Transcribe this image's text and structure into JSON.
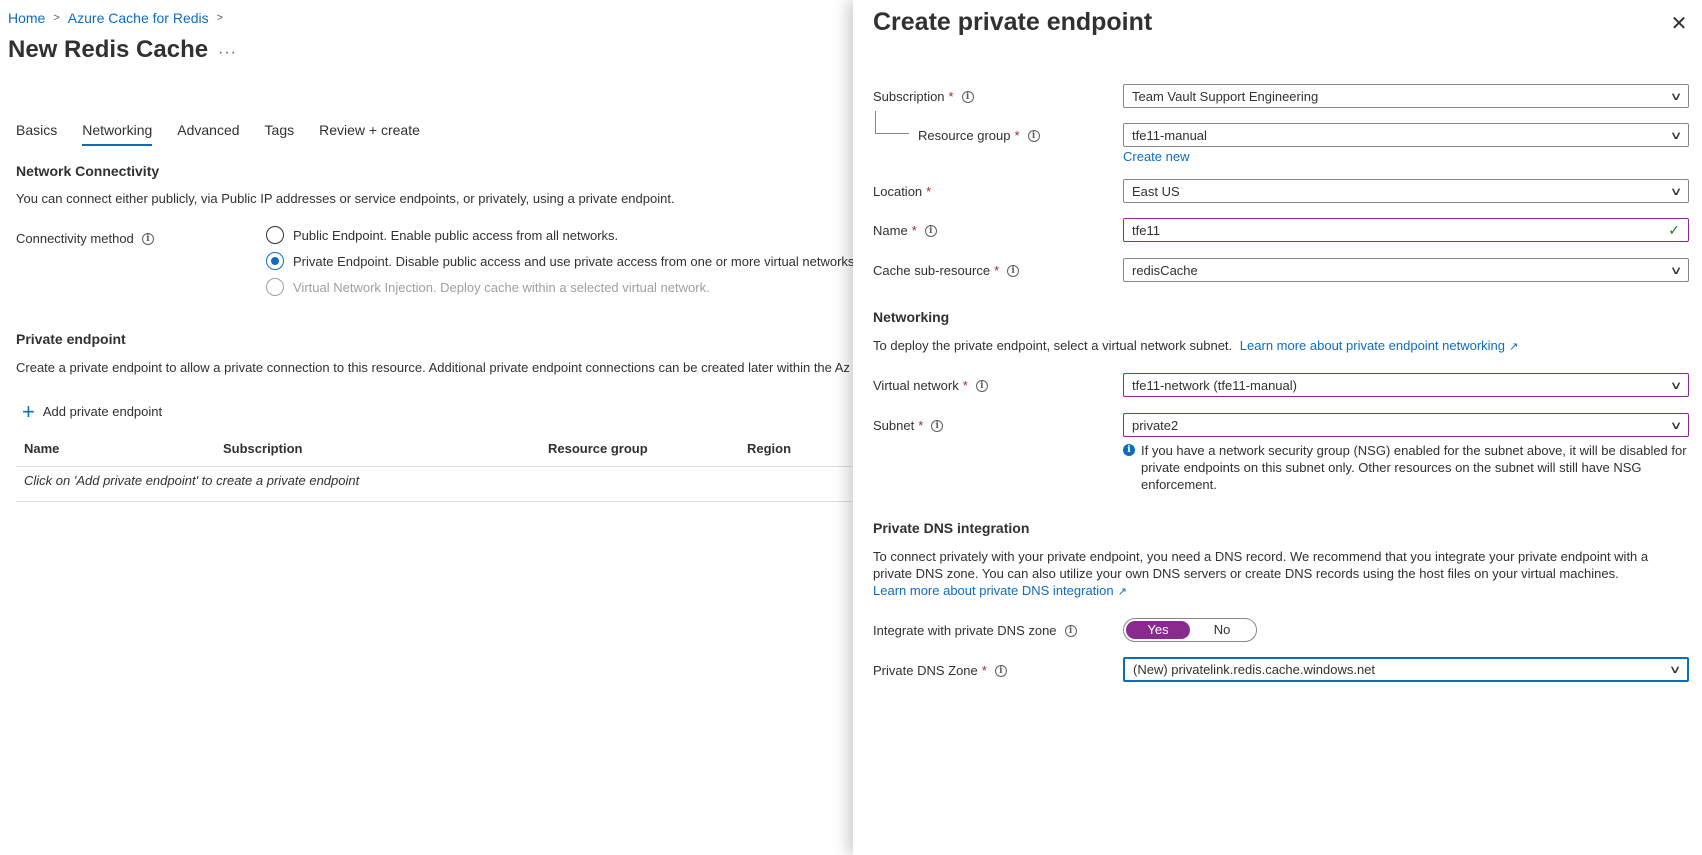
{
  "breadcrumb": {
    "items": [
      "Home",
      "Azure Cache for Redis"
    ]
  },
  "page": {
    "title": "New Redis Cache",
    "more": "···"
  },
  "tabs": [
    {
      "label": "Basics",
      "active": false
    },
    {
      "label": "Networking",
      "active": true
    },
    {
      "label": "Advanced",
      "active": false
    },
    {
      "label": "Tags",
      "active": false
    },
    {
      "label": "Review + create",
      "active": false
    }
  ],
  "network": {
    "title": "Network Connectivity",
    "description": "You can connect either publicly, via Public IP addresses or service endpoints, or privately, using a private endpoint.",
    "method_label": "Connectivity method",
    "options": [
      {
        "label": "Public Endpoint. Enable public access from all networks.",
        "checked": false,
        "disabled": false
      },
      {
        "label": "Private Endpoint. Disable public access and use private access from one or more virtual networks.",
        "checked": true,
        "disabled": false
      },
      {
        "label": "Virtual Network Injection. Deploy cache within a selected virtual network.",
        "checked": false,
        "disabled": true
      }
    ]
  },
  "private_endpoint": {
    "title": "Private endpoint",
    "description": "Create a private endpoint to allow a private connection to this resource. Additional private endpoint connections can be created later within the Az",
    "add_label": "Add private endpoint",
    "columns": [
      "Name",
      "Subscription",
      "Resource group",
      "Region"
    ],
    "empty_text": "Click on 'Add private endpoint' to create a private endpoint"
  },
  "panel": {
    "title": "Create private endpoint",
    "close": "✕",
    "subscription": {
      "label": "Subscription",
      "value": "Team Vault Support Engineering"
    },
    "resource_group": {
      "label": "Resource group",
      "value": "tfe11-manual",
      "create_new": "Create new"
    },
    "location": {
      "label": "Location",
      "value": "East US"
    },
    "name": {
      "label": "Name",
      "value": "tfe11"
    },
    "sub_resource": {
      "label": "Cache sub-resource",
      "value": "redisCache"
    },
    "networking": {
      "title": "Networking",
      "description": "To deploy the private endpoint, select a virtual network subnet.",
      "link": "Learn more about private endpoint networking"
    },
    "virtual_network": {
      "label": "Virtual network",
      "value": "tfe11-network (tfe11-manual)"
    },
    "subnet": {
      "label": "Subnet",
      "value": "private2",
      "note": "If you have a network security group (NSG) enabled for the subnet above, it will be disabled for private endpoints on this subnet only. Other resources on the subnet will still have NSG enforcement."
    },
    "dns": {
      "title": "Private DNS integration",
      "description": "To connect privately with your private endpoint, you need a DNS record. We recommend that you integrate your private endpoint with a private DNS zone. You can also utilize your own DNS servers or create DNS records using the host files on your virtual machines.",
      "link": "Learn more about private DNS integration",
      "integrate_label": "Integrate with private DNS zone",
      "yes": "Yes",
      "no": "No",
      "zone_label": "Private DNS Zone",
      "zone_value": "(New) privatelink.redis.cache.windows.net"
    }
  },
  "colors": {
    "link": "#0f6cbd",
    "accent": "#8a2a91",
    "required": "#a4262c",
    "valid": "#107c10"
  },
  "icons": [
    "chevron-right-icon",
    "more-icon",
    "info-icon",
    "plus-icon",
    "close-icon",
    "chevron-down-icon",
    "checkmark-icon",
    "external-link-icon"
  ]
}
